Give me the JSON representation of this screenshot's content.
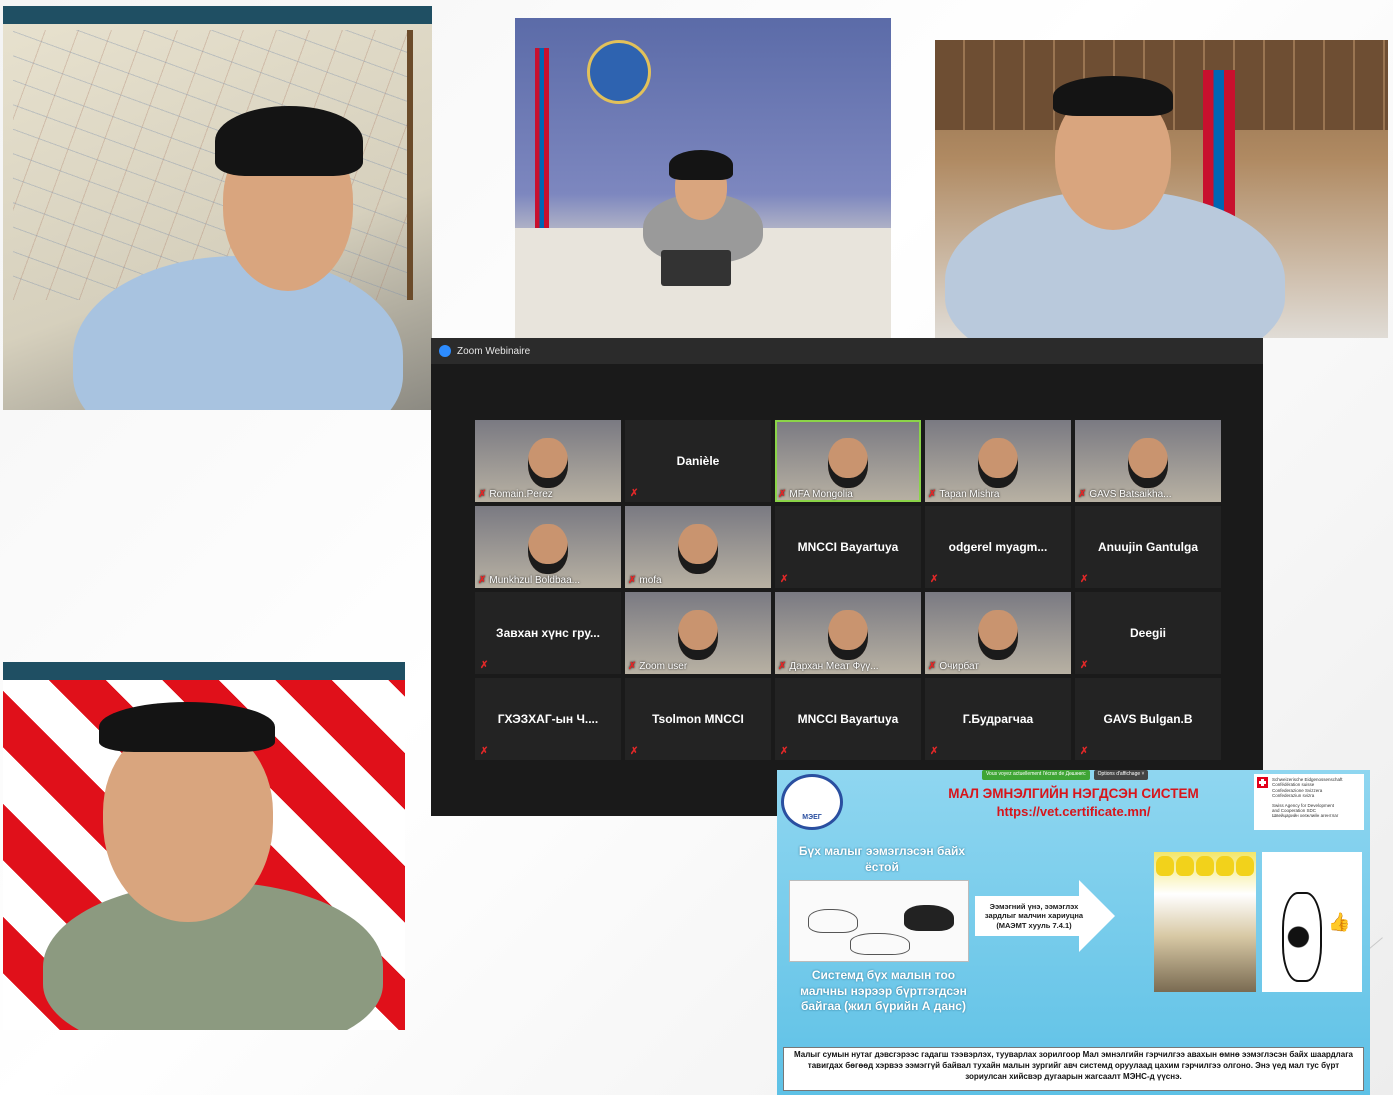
{
  "zoom": {
    "title": "Zoom Webinaire",
    "participants": [
      {
        "name": "Romain.Perez",
        "video": true,
        "label_position": "corner"
      },
      {
        "name": "Danièle",
        "video": false,
        "label_position": "center"
      },
      {
        "name": "MFA Mongolia",
        "video": true,
        "label_position": "corner",
        "active_speaker": true
      },
      {
        "name": "Tapan Mishra",
        "video": true,
        "label_position": "corner"
      },
      {
        "name": "GAVS Batsaikha...",
        "video": true,
        "label_position": "corner"
      },
      {
        "name": "Munkhzul Boldbaa...",
        "video": true,
        "label_position": "corner"
      },
      {
        "name": "mofa",
        "video": true,
        "label_position": "corner"
      },
      {
        "name": "MNCCI Bayartuya",
        "video": false,
        "label_position": "center"
      },
      {
        "name": "odgerel  myagm...",
        "video": false,
        "label_position": "center"
      },
      {
        "name": "Anuujin Gantulga",
        "video": false,
        "label_position": "center"
      },
      {
        "name": "Завхан хүнс гру...",
        "video": false,
        "label_position": "center"
      },
      {
        "name": "Zoom user",
        "video": true,
        "label_position": "corner"
      },
      {
        "name": "Дархан Меат Фүү...",
        "video": true,
        "label_position": "corner"
      },
      {
        "name": "Очирбат",
        "video": true,
        "label_position": "corner"
      },
      {
        "name": "Deegii",
        "video": false,
        "label_position": "center"
      },
      {
        "name": "ГХЭЗХАГ-ын Ч....",
        "video": false,
        "label_position": "center"
      },
      {
        "name": "Tsolmon MNCCI",
        "video": false,
        "label_position": "center"
      },
      {
        "name": "MNCCI Bayartuya",
        "video": false,
        "label_position": "center"
      },
      {
        "name": "Г.Будрагчаа",
        "video": false,
        "label_position": "center"
      },
      {
        "name": "GAVS Bulgan.B",
        "video": false,
        "label_position": "center"
      }
    ]
  },
  "slide": {
    "share_banner": "Vous voyez actuellement l'écran de Дөшөөгс",
    "view_options": "Options d'affichage ˅",
    "seal_label": "МЭЕГ",
    "title": "МАЛ ЭМНЭЛГИЙН НЭГДСЭН СИСТЕМ",
    "url": "https://vet.certificate.mn/",
    "swiss_lines": [
      "Schweizerische Eidgenossenschaft",
      "Confédération suisse",
      "Confederazione Svizzera",
      "Confederaziun svizra",
      "Swiss Agency for Development",
      "and Cooperation SDC",
      "Швейцарийн хөгжлийн агентлаг"
    ],
    "left_heading": "Бүх малыг ээмэглэсэн байх ёстой",
    "arrow_text": "Ээмэгний үнэ, ээмэглэх зардлыг малчин хариуцна (МАЭМТ хууль 7.4.1)",
    "left_bottom": "Системд бүх малын тоо малчны нэрээр бүртгэгдсэн байгаа (жил бүрийн А данс)",
    "footer": "Малыг сумын нутаг дэвсгэрээс гадагш тээвэрлэх, тууварлах зорилгоор Мал эмнэлгийн гэрчилгээ авахын өмнө ээмэглэсэн байх шаардлага тавигдах бөгөөд хэрвээ ээмэггүй байвал тухайн малын зургийг авч системд оруулаад цахим гэрчилгээ олгоно. Энэ үед мал тус бүрт зориулсан хийсвэр дугаарын жагсаалт МЭНС-д үүснэ."
  },
  "colors": {
    "panel_bar": "#1f4f63",
    "zoom_bg": "#1a1a1a",
    "active_speaker": "#8bd448",
    "muted_icon": "#e02828",
    "slide_title": "#d8151b",
    "slide_bg": "#5ec1e6"
  },
  "icons": {
    "muted": "microphone-muted-icon",
    "zoom_logo": "zoom-logo-icon"
  }
}
